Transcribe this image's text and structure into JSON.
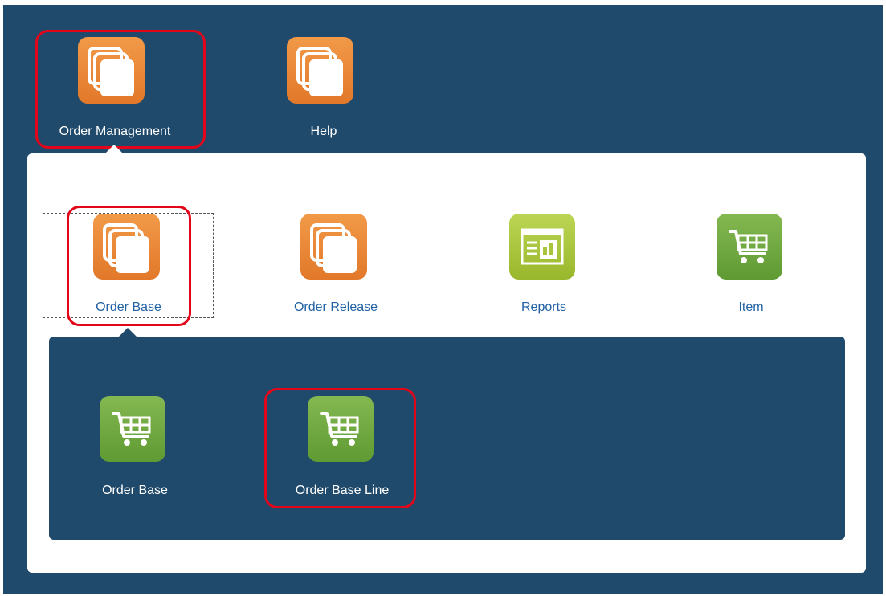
{
  "top_apps": [
    {
      "label": "Order Management",
      "icon": "stacked-pages-icon",
      "color": "#e8832f",
      "selected": true
    },
    {
      "label": "Help",
      "icon": "stacked-pages-icon",
      "color": "#e8832f",
      "selected": false
    }
  ],
  "sub_apps": [
    {
      "label": "Order Base",
      "icon": "stacked-pages-icon",
      "color": "#e8832f",
      "selected": true
    },
    {
      "label": "Order Release",
      "icon": "stacked-pages-icon",
      "color": "#e8832f",
      "selected": false
    },
    {
      "label": "Reports",
      "icon": "report-chart-icon",
      "color": "#a8c43a",
      "selected": false
    },
    {
      "label": "Item",
      "icon": "shopping-cart-icon",
      "color": "#6aa63c",
      "selected": false
    }
  ],
  "leaf_apps": [
    {
      "label": "Order Base",
      "icon": "shopping-cart-icon",
      "color": "#6aa63c",
      "selected": false
    },
    {
      "label": "Order Base Line",
      "icon": "shopping-cart-icon",
      "color": "#6aa63c",
      "selected": true
    }
  ],
  "colors": {
    "background": "#1f4a6c",
    "highlight": "#e3061a",
    "link": "#2161a6"
  }
}
